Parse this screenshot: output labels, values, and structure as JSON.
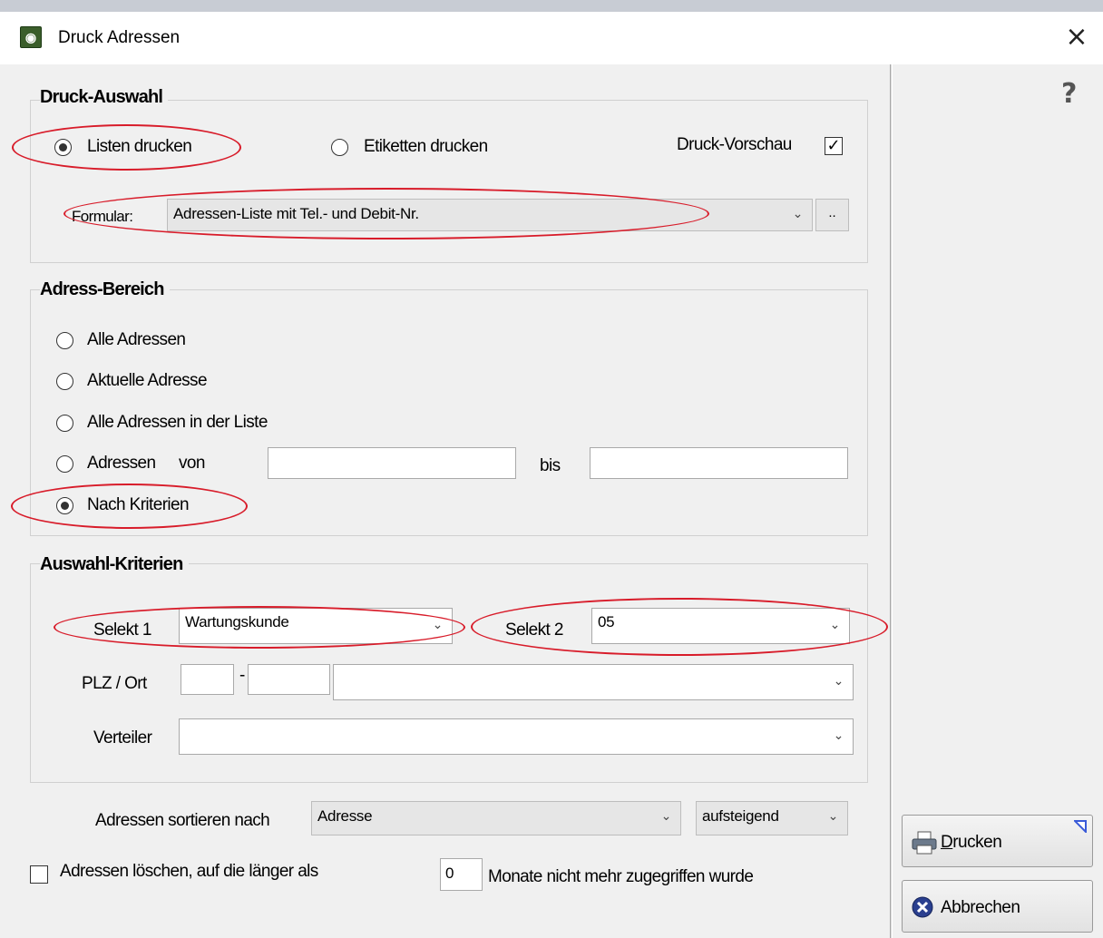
{
  "window": {
    "title": "Druck Adressen",
    "close_glyph": "×",
    "help_glyph": "?"
  },
  "druck_auswahl": {
    "title": "Druck-Auswahl",
    "option_listen": "Listen drucken",
    "option_etiketten": "Etiketten drucken",
    "selected": "Listen drucken",
    "preview_label": "Druck-Vorschau",
    "preview_checked": true,
    "formular_label": "Formular:",
    "formular_value": "Adressen-Liste mit Tel.- und Debit-Nr.",
    "browse_label": ".."
  },
  "adress_bereich": {
    "title": "Adress-Bereich",
    "options": [
      "Alle Adressen",
      "Aktuelle Adresse",
      "Alle Adressen in der Liste",
      "Adressen",
      "Nach Kriterien"
    ],
    "von_label": "von",
    "bis_label": "bis",
    "von_value": "",
    "bis_value": "",
    "selected": "Nach Kriterien"
  },
  "auswahl_kriterien": {
    "title": "Auswahl-Kriterien",
    "selekt1_label": "Selekt 1",
    "selekt1_value": "Wartungskunde",
    "selekt2_label": "Selekt 2",
    "selekt2_value": "05",
    "plz_label": "PLZ / Ort",
    "plz_dash": "-",
    "plz_from": "",
    "plz_to": "",
    "ort_value": "",
    "verteiler_label": "Verteiler",
    "verteiler_value": ""
  },
  "sort": {
    "label": "Adressen sortieren nach",
    "field_value": "Adresse",
    "order_value": "aufsteigend"
  },
  "delete": {
    "checked": false,
    "label": "Adressen löschen, auf die länger als",
    "months_value": "0",
    "suffix": "Monate nicht mehr zugegriffen wurde"
  },
  "buttons": {
    "print_accel": "D",
    "print_rest": "rucken",
    "cancel": "Abbrechen"
  },
  "icons": {
    "app": "app-icon",
    "printer": "printer-icon",
    "cancel": "cancel-icon"
  },
  "colors": {
    "annotation": "#d81c2a",
    "background": "#f0f0f0"
  }
}
